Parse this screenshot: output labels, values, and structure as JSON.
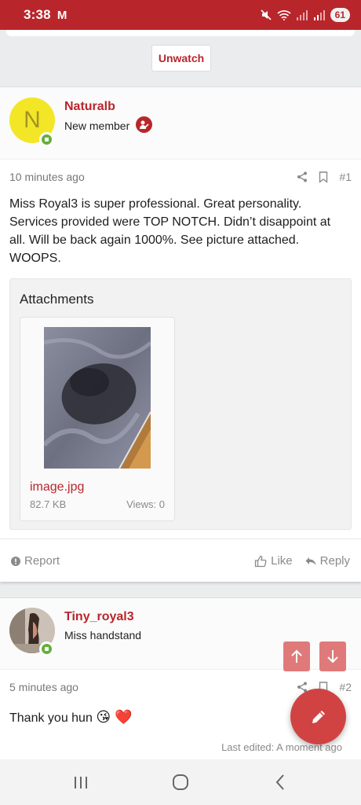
{
  "status_bar": {
    "time": "3:38",
    "mail_icon": "M",
    "battery": "61"
  },
  "thread": {
    "unwatch_label": "Unwatch"
  },
  "post1": {
    "username": "Naturalb",
    "avatar_letter": "N",
    "user_title": "New member",
    "timestamp": "10 minutes ago",
    "post_number": "#1",
    "body_lines": [
      "Miss Royal3 is super professional. Great personality.",
      "Services provided were TOP NOTCH. Didn’t disappoint at",
      "all. Will be back again 1000%. See picture attached.",
      "WOOPS."
    ],
    "attachments_title": "Attachments",
    "attachment": {
      "name": "image.jpg",
      "size": "82.7 KB",
      "views": "Views: 0"
    },
    "report_label": "Report",
    "like_label": "Like",
    "reply_label": "Reply"
  },
  "post2": {
    "username": "Tiny_royal3",
    "user_title": "Miss handstand",
    "timestamp": "5 minutes ago",
    "post_number": "#2",
    "body": "Thank you hun",
    "emojis": "😘 ❤️",
    "last_edited": "Last edited: A moment ago"
  },
  "colors": {
    "accent": "#b8262b",
    "online": "#63b03a",
    "avatar_bg": "#f3e627"
  }
}
